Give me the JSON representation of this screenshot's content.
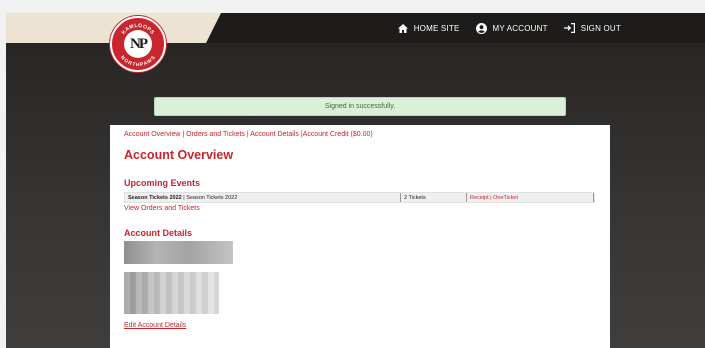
{
  "header": {
    "logo_top_text": "KAMLOOPS",
    "logo_letters": "NP",
    "logo_bottom_text": "NORTHPAWS",
    "nav": [
      {
        "label": "HOME SITE",
        "icon": "home-icon"
      },
      {
        "label": "MY ACCOUNT",
        "icon": "account-icon"
      },
      {
        "label": "SIGN OUT",
        "icon": "sign-out-icon"
      }
    ]
  },
  "flash": {
    "message": "Signed in successfully."
  },
  "subnav": {
    "overview": "Account Overview",
    "orders": "Orders and Tickets",
    "details": "Account Details",
    "credit": "Account Credit ($0.00)",
    "sep": "|"
  },
  "main": {
    "title": "Account Overview",
    "upcoming": {
      "heading": "Upcoming Events",
      "rows": [
        {
          "event_bold": "Season Tickets 2022",
          "event_rest": " | Season Tickets 2022",
          "quantity": "2 Tickets",
          "receipt": "Receipt",
          "sep": " | ",
          "oneticket": "OneTicket"
        }
      ],
      "view_link": "View Orders and Tickets"
    },
    "account_details": {
      "heading": "Account Details",
      "edit_link": "Edit Account Details"
    }
  },
  "colors": {
    "accent": "#c8252c",
    "flash_bg": "#dcefd8",
    "topbar": "#1d1c1b",
    "logo_panel": "#ece3d2"
  }
}
